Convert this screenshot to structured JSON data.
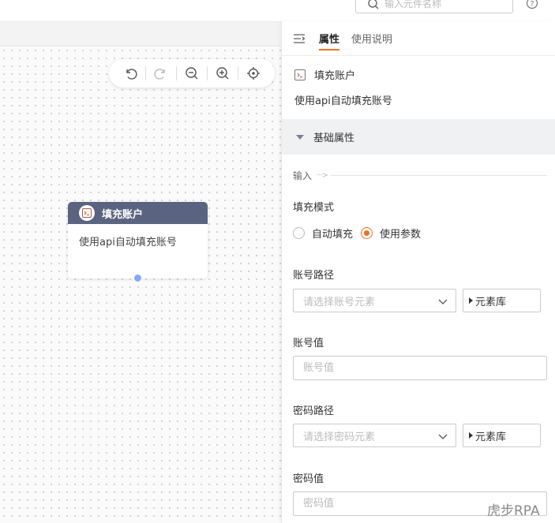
{
  "header": {
    "search_placeholder": "输入元件名称"
  },
  "toolbar": {
    "buttons": [
      "undo",
      "redo",
      "zoom-out",
      "zoom-in",
      "locate"
    ]
  },
  "node": {
    "title": "填充账户",
    "desc": "使用api自动填充账号"
  },
  "panel": {
    "tabs": [
      {
        "label": "属性",
        "active": true
      },
      {
        "label": "使用说明",
        "active": false
      }
    ],
    "component_name": "填充账户",
    "component_desc": "使用api自动填充账号",
    "section_title": "基础属性",
    "input_label": "输入",
    "fill_mode": {
      "label": "填充模式",
      "options": [
        "自动填充",
        "使用参数"
      ],
      "selected": "使用参数"
    },
    "account_path": {
      "label": "账号路径",
      "placeholder": "请选择账号元素",
      "lib_label": "元素库"
    },
    "account_value": {
      "label": "账号值",
      "placeholder": "账号值"
    },
    "password_path": {
      "label": "密码路径",
      "placeholder": "请选择密码元素",
      "lib_label": "元素库"
    },
    "password_value": {
      "label": "密码值",
      "placeholder": "密码值"
    }
  },
  "watermark": "虎步RPA",
  "colors": {
    "accent": "#f07020",
    "node_header": "#5a6481",
    "port": "#86a9f5"
  }
}
